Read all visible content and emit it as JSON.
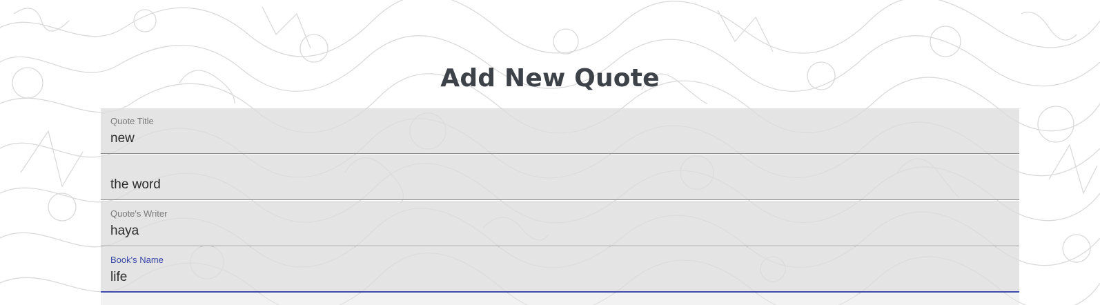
{
  "page": {
    "heading": "Add New Quote"
  },
  "form": {
    "fields": [
      {
        "label": "Quote Title",
        "value": "new",
        "focused": false
      },
      {
        "label": "",
        "value": "the word",
        "focused": false
      },
      {
        "label": "Quote's Writer",
        "value": "haya",
        "focused": false
      },
      {
        "label": "Book's Name",
        "value": "life",
        "focused": true
      }
    ]
  },
  "colors": {
    "heading": "#3d4248",
    "field_background": "#dddddd",
    "focus_accent": "#3849a8",
    "label": "#7a7a7a",
    "underline": "#8b8b8b"
  },
  "background": {
    "icon": "arabic-calligraphy-pattern"
  }
}
